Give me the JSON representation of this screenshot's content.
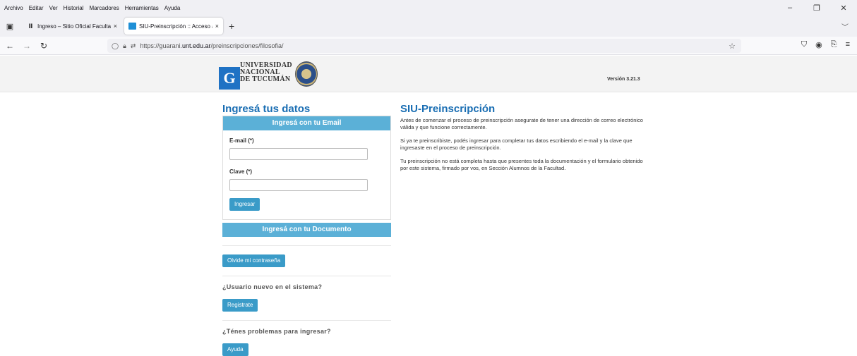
{
  "browser": {
    "menu": [
      "Archivo",
      "Editar",
      "Ver",
      "Historial",
      "Marcadores",
      "Herramientas",
      "Ayuda"
    ],
    "tabs": [
      {
        "title": "Ingreso – Sitio Oficial Facultad",
        "close": "×"
      },
      {
        "title": "SIU-Preinscripción :: Acceso al",
        "close": "×"
      }
    ],
    "new_tab": "+",
    "url": {
      "prefix": "https://guarani.",
      "host": "unt.edu.ar",
      "path": "/preinscripciones/filosofia/"
    }
  },
  "header": {
    "logo_g": "G",
    "logo_lines": [
      "UNIVERSIDAD",
      "NACIONAL",
      "DE TUCUMÁN"
    ],
    "version": "Versión 3.21.3"
  },
  "login": {
    "title": "Ingresá tus datos",
    "email_panel_title": "Ingresá con tu Email",
    "email_label": "E-mail (*)",
    "email_value": "",
    "password_label": "Clave (*)",
    "password_value": "",
    "submit_label": "Ingresar",
    "document_panel_title": "Ingresá con tu Documento",
    "forgot_label": "Olvide mi contraseña",
    "new_user_question": "¿Usuario nuevo en el sistema?",
    "register_label": "Registrate",
    "problems_question": "¿Ténes problemas para ingresar?",
    "help_label": "Ayuda"
  },
  "info": {
    "title": "SIU-Preinscripción",
    "paragraphs": [
      "Antes de comenzar el proceso de preinscripción asegurate de tener una dirección de correo electrónico válida y que funcione correctamente.",
      "Si ya te preinscribiste, podés ingresar para completar tus datos escribiendo el e-mail y la clave que ingresaste en el proceso de preinscripción.",
      "Tu preinscripción no está completa hasta que presentes toda la documentación y el formulario obtenido por este sistema, firmado por vos, en Sección Alumnos de la Facultad."
    ]
  }
}
